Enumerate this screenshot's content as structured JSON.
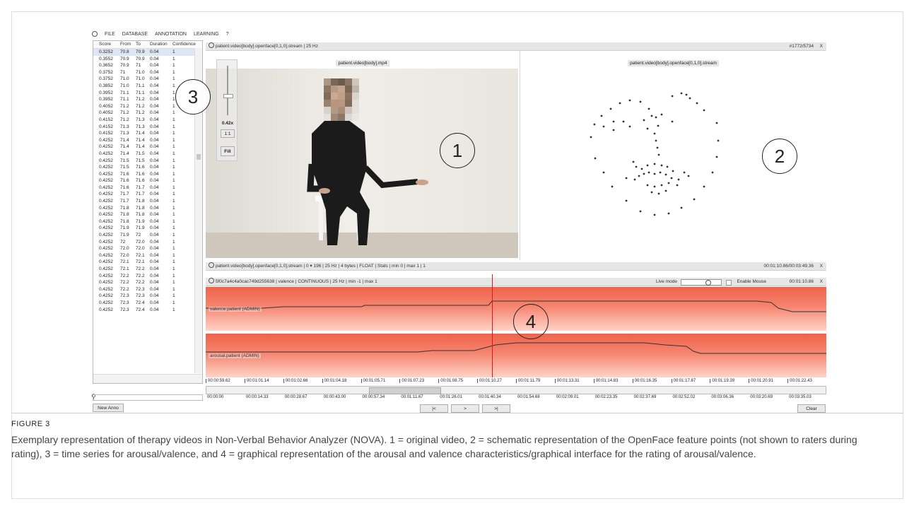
{
  "menu": [
    "FILE",
    "DATABASE",
    "ANNOTATION",
    "LEARNING",
    "?"
  ],
  "table": {
    "headers": [
      "Score",
      "From",
      "To",
      "Duration",
      "Confidence"
    ],
    "rows": [
      [
        "0.3252",
        "70.8",
        "70.9",
        "0.04",
        "1"
      ],
      [
        "0.3552",
        "70.9",
        "70.9",
        "0.04",
        "1"
      ],
      [
        "0.3652",
        "70.9",
        "71",
        "0.04",
        "1"
      ],
      [
        "0.3752",
        "71",
        "71.0",
        "0.04",
        "1"
      ],
      [
        "0.3752",
        "71.0",
        "71.0",
        "0.04",
        "1"
      ],
      [
        "0.3852",
        "71.0",
        "71.1",
        "0.04",
        "1"
      ],
      [
        "0.3952",
        "71.1",
        "71.1",
        "0.04",
        "1"
      ],
      [
        "0.3952",
        "71.1",
        "71.2",
        "0.04",
        "1"
      ],
      [
        "0.4052",
        "71.2",
        "71.2",
        "0.04",
        "1"
      ],
      [
        "0.4052",
        "71.2",
        "71.2",
        "0.04",
        "1"
      ],
      [
        "0.4152",
        "71.2",
        "71.3",
        "0.04",
        "1"
      ],
      [
        "0.4152",
        "71.3",
        "71.3",
        "0.04",
        "1"
      ],
      [
        "0.4152",
        "71.3",
        "71.4",
        "0.04",
        "1"
      ],
      [
        "0.4252",
        "71.4",
        "71.4",
        "0.04",
        "1"
      ],
      [
        "0.4252",
        "71.4",
        "71.4",
        "0.04",
        "1"
      ],
      [
        "0.4252",
        "71.4",
        "71.5",
        "0.04",
        "1"
      ],
      [
        "0.4252",
        "71.5",
        "71.5",
        "0.04",
        "1"
      ],
      [
        "0.4252",
        "71.5",
        "71.6",
        "0.04",
        "1"
      ],
      [
        "0.4252",
        "71.6",
        "71.6",
        "0.04",
        "1"
      ],
      [
        "0.4252",
        "71.6",
        "71.6",
        "0.04",
        "1"
      ],
      [
        "0.4252",
        "71.6",
        "71.7",
        "0.04",
        "1"
      ],
      [
        "0.4252",
        "71.7",
        "71.7",
        "0.04",
        "1"
      ],
      [
        "0.4252",
        "71.7",
        "71.8",
        "0.04",
        "1"
      ],
      [
        "0.4252",
        "71.8",
        "71.8",
        "0.04",
        "1"
      ],
      [
        "0.4252",
        "71.8",
        "71.8",
        "0.04",
        "1"
      ],
      [
        "0.4252",
        "71.8",
        "71.9",
        "0.04",
        "1"
      ],
      [
        "0.4252",
        "71.9",
        "71.9",
        "0.04",
        "1"
      ],
      [
        "0.4252",
        "71.9",
        "72",
        "0.04",
        "1"
      ],
      [
        "0.4252",
        "72",
        "72.0",
        "0.04",
        "1"
      ],
      [
        "0.4252",
        "72.0",
        "72.0",
        "0.04",
        "1"
      ],
      [
        "0.4252",
        "72.0",
        "72.1",
        "0.04",
        "1"
      ],
      [
        "0.4252",
        "72.1",
        "72.1",
        "0.04",
        "1"
      ],
      [
        "0.4252",
        "72.1",
        "72.2",
        "0.04",
        "1"
      ],
      [
        "0.4252",
        "72.2",
        "72.2",
        "0.04",
        "1"
      ],
      [
        "0.4252",
        "72.2",
        "72.2",
        "0.04",
        "1"
      ],
      [
        "0.4252",
        "72.2",
        "72.3",
        "0.04",
        "1"
      ],
      [
        "0.4252",
        "72.3",
        "72.3",
        "0.04",
        "1"
      ],
      [
        "0.4252",
        "72.3",
        "72.4",
        "0.04",
        "1"
      ],
      [
        "0.4252",
        "72.3",
        "72.4",
        "0.04",
        "1"
      ]
    ]
  },
  "new_anno": "New Anno",
  "video_header": "patient.video[body].openface[0,1,0].stream",
  "video_header_rate": "25 Hz",
  "frame_counter": "#1772/5734",
  "close_x": "X",
  "video_title": "patient.video[body].mp4",
  "face_title": "patient.video[body].openface[0,1,0].stream",
  "zoom": "0.42x",
  "btn_11": "1:1",
  "btn_fill": "Fill",
  "markers": [
    "1",
    "2",
    "3",
    "4"
  ],
  "stream_bar": {
    "name": "patient.video[body].openface[0,1,0].stream",
    "dim": "0",
    "dim_max": "196",
    "rate": "25 Hz",
    "bytes": "4 bytes",
    "type": "FLOAT",
    "stats": "Stats",
    "min": "min 0",
    "max": "max 1",
    "count": "1",
    "time": "00:01:10.86/00:03:49.36"
  },
  "anno_bar": {
    "id": "5f0c7a4c4a0cac749d255638",
    "scheme": "valence",
    "kind": "CONTINUOUS",
    "rate": "25 Hz",
    "min": "min -1",
    "max": "max 1",
    "live_mode": "Live mode",
    "enable_mouse": "Enable Mouse",
    "time": "00:01:10.86"
  },
  "tracks": [
    "valence.patient (ADMIN)",
    "arousal.patient (ADMIN)"
  ],
  "timeline_ticks": [
    "00:00:59.62",
    "00:01:01.14",
    "00:01:02.66",
    "00:01:04.18",
    "00:01:05.71",
    "00:01:07.23",
    "00:01:08.75",
    "00:01:10.27",
    "00:01:11.79",
    "00:01:13.31",
    "00:01:14.83",
    "00:01:16.35",
    "00:01:17.87",
    "00:01:19.39",
    "00:01:20.91",
    "00:01:22.43"
  ],
  "overview_ticks": [
    "00:00:00",
    "00:00:14.33",
    "00:00:28.67",
    "00:00:43.00",
    "00:00:57.34",
    "00:01:11.67",
    "00:01:26.01",
    "00:01:40.34",
    "00:01:54.68",
    "00:02:09.01",
    "00:02:23.35",
    "00:02:37.69",
    "00:02:52.02",
    "00:03:06.36",
    "00:03:20.69",
    "00:03:35.03"
  ],
  "nav_buttons": [
    "|<",
    ">",
    ">|"
  ],
  "clear": "Clear",
  "figure_label": "FIGURE 3",
  "caption": "Exemplary representation of therapy videos in Non-Verbal Behavior Analyzer (NOVA). 1 = original video, 2 = schematic representation of the OpenFace feature points (not shown to raters during rating), 3 = time series for arousal/valence, and 4 = graphical representation of the arousal and valence characteristics/graphical interface for the rating of arousal/valence.",
  "colors": {
    "track_red": "#f0624a",
    "track_light": "#ffd9cf",
    "cursor": "#d21b1b"
  }
}
